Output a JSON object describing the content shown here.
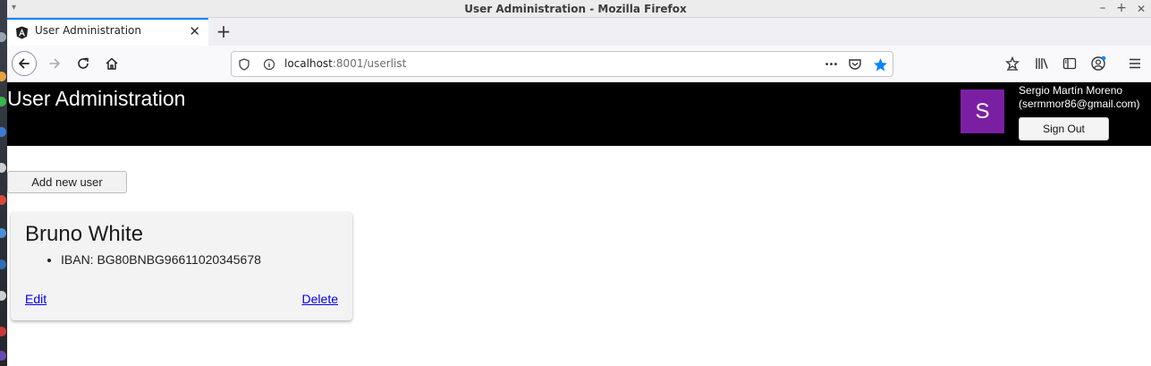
{
  "window": {
    "title": "User Administration - Mozilla Firefox",
    "minimize_label": "–",
    "maximize_label": "+",
    "close_label": "✕"
  },
  "tab": {
    "title": "User Administration",
    "close_label": "✕",
    "new_tab_label": "+"
  },
  "urlbar": {
    "host": "localhost",
    "path": ":8001/userlist",
    "more_label": "•••"
  },
  "app": {
    "title": "User Administration",
    "user": {
      "avatar_letter": "S",
      "name": "Sergio Martín Moreno",
      "email": "(sermmor86@gmail.com)",
      "sign_out_label": "Sign Out"
    },
    "add_user_label": "Add new user",
    "users": [
      {
        "name": "Bruno White",
        "details": [
          "IBAN: BG80BNBG96611020345678"
        ],
        "edit_label": "Edit",
        "delete_label": "Delete"
      }
    ]
  },
  "colors": {
    "header_bg": "#000000",
    "avatar_bg": "#7b1fa2",
    "link": "#0000ee",
    "tab_accent": "#0a84ff"
  }
}
